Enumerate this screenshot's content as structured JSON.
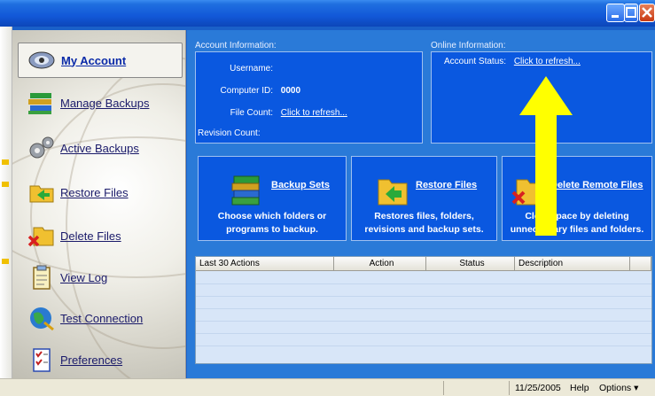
{
  "window": {
    "controls": [
      "minimize-icon",
      "maximize-icon",
      "close-icon"
    ]
  },
  "sidebar": {
    "items": [
      {
        "label": "My Account",
        "icon": "my-account-icon",
        "selected": true
      },
      {
        "label": "Manage Backups",
        "icon": "manage-backups-icon"
      },
      {
        "label": "Active Backups",
        "icon": "active-backups-icon"
      },
      {
        "label": "Restore Files",
        "icon": "restore-files-icon"
      },
      {
        "label": "Delete Files",
        "icon": "delete-files-icon"
      },
      {
        "label": "View Log",
        "icon": "view-log-icon"
      },
      {
        "label": "Test Connection",
        "icon": "test-connection-icon"
      },
      {
        "label": "Preferences",
        "icon": "preferences-icon"
      }
    ]
  },
  "account": {
    "heading": "Account Information:",
    "username_label": "Username:",
    "username_value": "",
    "computer_id_label": "Computer ID:",
    "computer_id_value": "0000",
    "file_count_label": "File Count:",
    "file_count_link": "Click to refresh...",
    "revision_count_label": "Revision Count:"
  },
  "online": {
    "heading": "Online Information:",
    "status_label": "Account Status:",
    "status_link": "Click to refresh..."
  },
  "actions": {
    "backup_sets": {
      "title": "Backup Sets",
      "line1": "Choose which folders or",
      "line2": "programs to backup."
    },
    "restore_files": {
      "title": "Restore Files",
      "line1": "Restores files, folders,",
      "line2": "revisions and backup sets."
    },
    "delete_remote": {
      "title": "Delete Remote Files",
      "line1": "Clear space by deleting",
      "line2": "unnecessary files and folders."
    }
  },
  "grid": {
    "columns": [
      "Last 30 Actions",
      "Action",
      "Status",
      "Description"
    ],
    "rows": []
  },
  "statusbar": {
    "date": "11/25/2005",
    "help": "Help",
    "options": "Options ▾"
  },
  "colors": {
    "titlebar": "#1258d8",
    "panel": "#0a58e0",
    "main_bg": "#2a7ad8",
    "annotation_arrow": "#ffff00"
  }
}
